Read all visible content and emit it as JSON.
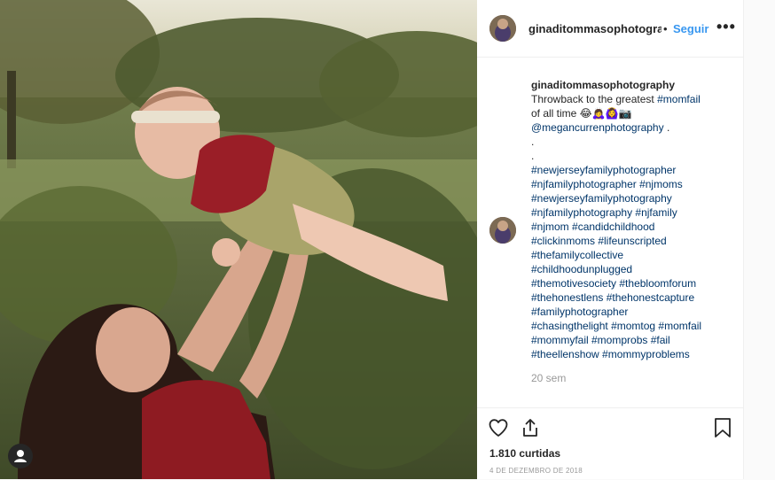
{
  "post": {
    "username": "ginaditommasophotograp",
    "separator": "•",
    "follow_label": "Seguir",
    "more_icon": "more-options-icon",
    "more_glyph": "•••"
  },
  "caption": {
    "username": "ginaditommasophotography",
    "line1": "Throwback to the greatest",
    "line1_tag": "#momfail",
    "line2": "of all time 😂🙇‍♀️🙆‍♀️📷",
    "mention": "@megancurrenphotography",
    "mention_tail": " .",
    "dot1": ".",
    "dot2": ".",
    "hashtag_lines": [
      "#newjerseyfamilyphotographer",
      "#njfamilyphotographer #njmoms",
      "#newjerseyfamilyphotography",
      "#njfamilyphotography #njfamily",
      "#njmom #candidchildhood",
      "#clickinmoms #lifeunscripted",
      "#thefamilycollective",
      "#childhoodunplugged",
      "#themotivesociety #thebloomforum",
      "#thehonestlens #thehonestcapture",
      "#familyphotographer",
      "#chasingthelight #momtog #momfail",
      "#mommyfail #momprobs #fail",
      "#theellenshow #mommyproblems"
    ],
    "time": "20 sem"
  },
  "footer": {
    "likes": "1.810 curtidas",
    "date": "4 DE DEZEMBRO DE 2018"
  },
  "colors": {
    "link": "#003569",
    "follow": "#3897f0",
    "muted": "#999999"
  }
}
